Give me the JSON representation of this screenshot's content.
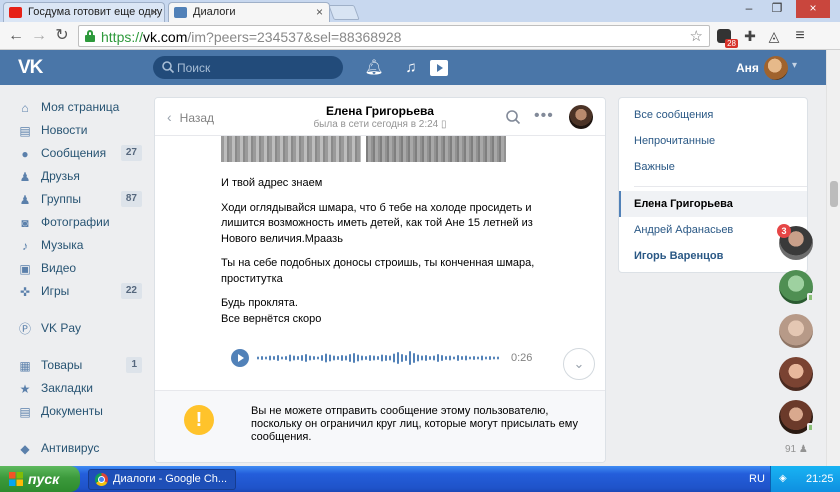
{
  "browser": {
    "tabs": [
      {
        "title": "Госдума готовит еще одну"
      },
      {
        "title": "Диалоги"
      }
    ],
    "url": {
      "scheme": "https://",
      "host": "vk.com",
      "path": "/im?peers=234537&sel=88368928"
    },
    "ext_badge": "28"
  },
  "header": {
    "search_placeholder": "Поиск",
    "user_name": "Аня"
  },
  "left_menu": [
    {
      "label": "Моя страница",
      "icon": "home-icon",
      "count": ""
    },
    {
      "label": "Новости",
      "icon": "news-icon",
      "count": ""
    },
    {
      "label": "Сообщения",
      "icon": "chat-icon",
      "count": "27"
    },
    {
      "label": "Друзья",
      "icon": "person-icon",
      "count": ""
    },
    {
      "label": "Группы",
      "icon": "group-icon",
      "count": "87"
    },
    {
      "label": "Фотографии",
      "icon": "photo-icon",
      "count": ""
    },
    {
      "label": "Музыка",
      "icon": "music-icon",
      "count": ""
    },
    {
      "label": "Видео",
      "icon": "video-icon",
      "count": ""
    },
    {
      "label": "Игры",
      "icon": "gamepad-icon",
      "count": "22"
    },
    {
      "label": "VK Pay",
      "icon": "vkpay-icon",
      "count": ""
    },
    {
      "label": "Товары",
      "icon": "cart-icon",
      "count": "1"
    },
    {
      "label": "Закладки",
      "icon": "star-icon",
      "count": ""
    },
    {
      "label": "Документы",
      "icon": "document-icon",
      "count": ""
    },
    {
      "label": "Антивирус",
      "icon": "shield-icon",
      "count": ""
    }
  ],
  "dialog": {
    "back_label": "Назад",
    "contact_name": "Елена Григорьева",
    "status": "была в сети сегодня в 2:24",
    "messages": [
      "И твой адрес знаем",
      "Ходи оглядывайся шмара, что б тебе на холоде просидеть и лишится возможность иметь детей, как той Ане 15 летней из Нового величия.Мраазь",
      "Ты на себе подобных доносы строишь, ты конченная шмара, проститутка",
      "Будь проклята.\nВсе вернётся скоро"
    ],
    "voice_duration": "0:26",
    "blocked_text": "Вы не можете отправить сообщение этому пользователю, поскольку он ограничил круг лиц, которые могут присылать ему сообщения."
  },
  "right_panel": {
    "filters": [
      "Все сообщения",
      "Непрочитанные",
      "Важные"
    ],
    "chats": [
      "Елена Григорьева",
      "Андрей Афанасьев",
      "Игорь Варенцов"
    ]
  },
  "chat_bubbles": {
    "first_unread": "3",
    "more_count": "91"
  },
  "taskbar": {
    "start_label": "пуск",
    "window_title": "Диалоги - Google Ch...",
    "language": "RU",
    "time": "21:25"
  }
}
